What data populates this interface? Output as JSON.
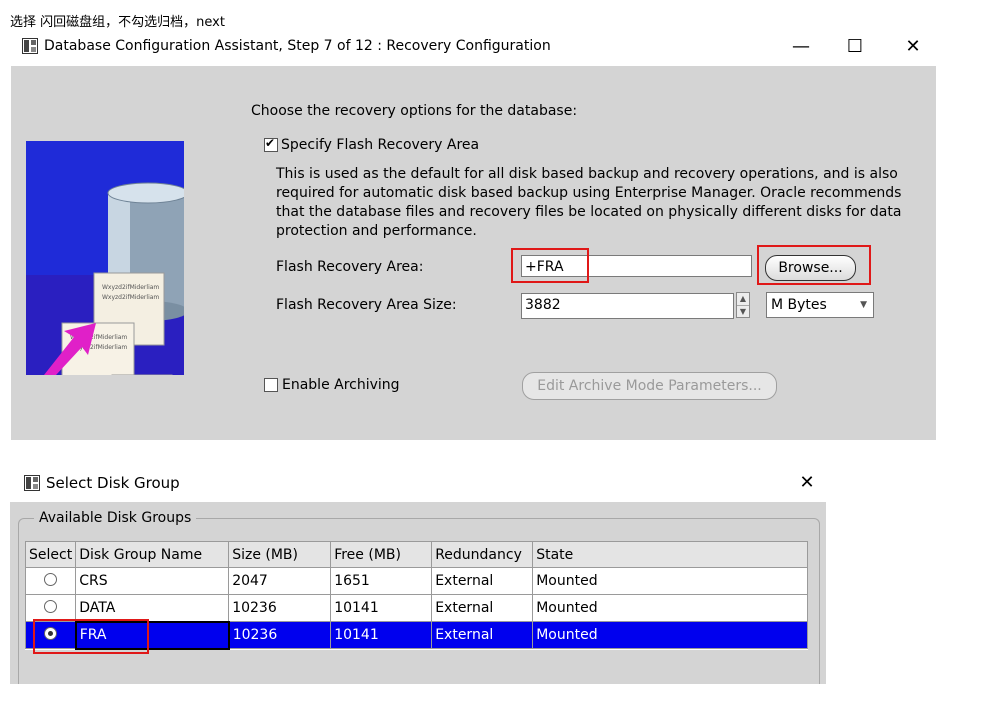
{
  "caption": "选择 闪回磁盘组，不勾选归档，next",
  "window1": {
    "title": "Database Configuration Assistant, Step 7 of 12 : Recovery Configuration",
    "minimize": "—",
    "maximize": "☐",
    "close": "✕",
    "intro": "Choose the recovery options for the database:",
    "flash_checkbox_label": "Specify Flash Recovery Area",
    "flash_checked": true,
    "description": "This is used as the default for all disk based backup and recovery operations, and is also required for automatic disk based backup using Enterprise Manager. Oracle recommends that the database files and recovery files be located on physically different disks for data protection and performance.",
    "fra_label": "Flash Recovery Area:",
    "fra_value": "+FRA",
    "browse_label": "Browse...",
    "size_label": "Flash Recovery Area Size:",
    "size_value": "3882",
    "unit_value": "M Bytes",
    "archiving_label": "Enable Archiving",
    "archiving_checked": false,
    "archive_button_label": "Edit Archive Mode Parameters...",
    "doc_text": "Wxyzd2ifMiderliam"
  },
  "window2": {
    "title": "Select Disk Group",
    "close": "✕",
    "group_label": "Available Disk Groups",
    "columns": [
      "Select",
      "Disk Group Name",
      "Size (MB)",
      "Free (MB)",
      "Redundancy",
      "State"
    ],
    "rows": [
      {
        "name": "CRS",
        "size": "2047",
        "free": "1651",
        "redundancy": "External",
        "state": "Mounted",
        "selected": false
      },
      {
        "name": "DATA",
        "size": "10236",
        "free": "10141",
        "redundancy": "External",
        "state": "Mounted",
        "selected": false
      },
      {
        "name": "FRA",
        "size": "10236",
        "free": "10141",
        "redundancy": "External",
        "state": "Mounted",
        "selected": true
      }
    ]
  },
  "colors": {
    "panel_bg": "#d4d4d4",
    "highlight_red": "#e01818",
    "selected_row": "#0000ee",
    "art_blue": "#1f2bd8",
    "arrow_magenta": "#e020c8"
  }
}
